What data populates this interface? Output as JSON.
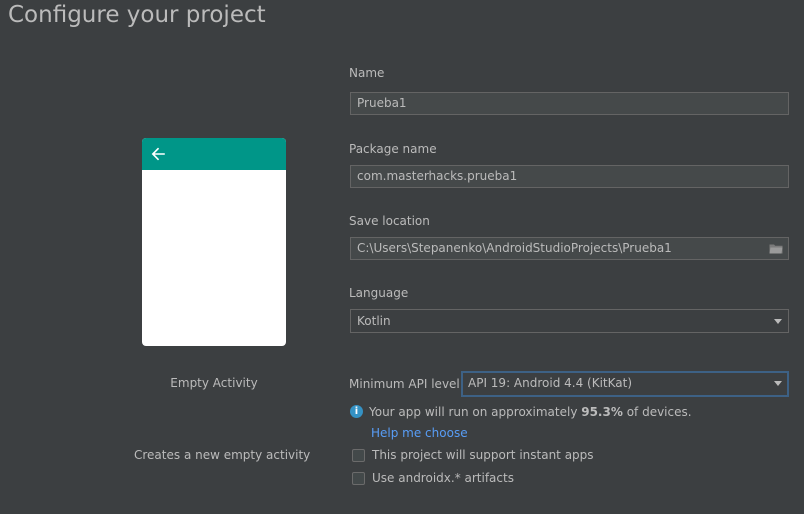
{
  "header": {
    "title": "Configure your project"
  },
  "template": {
    "name": "Empty Activity",
    "description": "Creates a new empty activity"
  },
  "form": {
    "name": {
      "label": "Name",
      "value": "Prueba1"
    },
    "package": {
      "label": "Package name",
      "value": "com.masterhacks.prueba1"
    },
    "save_location": {
      "label": "Save location",
      "value": "C:\\Users\\Stepanenko\\AndroidStudioProjects\\Prueba1"
    },
    "language": {
      "label": "Language",
      "value": "Kotlin"
    },
    "min_api": {
      "label": "Minimum API level",
      "value": "API 19: Android 4.4 (KitKat)"
    },
    "info": {
      "icon": "i",
      "text_before": "Your app will run on approximately ",
      "percent": "95.3%",
      "text_after": " of devices."
    },
    "help_link": "Help me choose",
    "instant_apps": {
      "label": "This project will support instant apps",
      "checked": false
    },
    "androidx": {
      "label": "Use androidx.* artifacts",
      "checked": false
    }
  },
  "colors": {
    "background": "#3c3f41",
    "app_bar": "#009688",
    "link": "#589df6",
    "focus_border": "#3d6185",
    "info": "#3592c4"
  }
}
